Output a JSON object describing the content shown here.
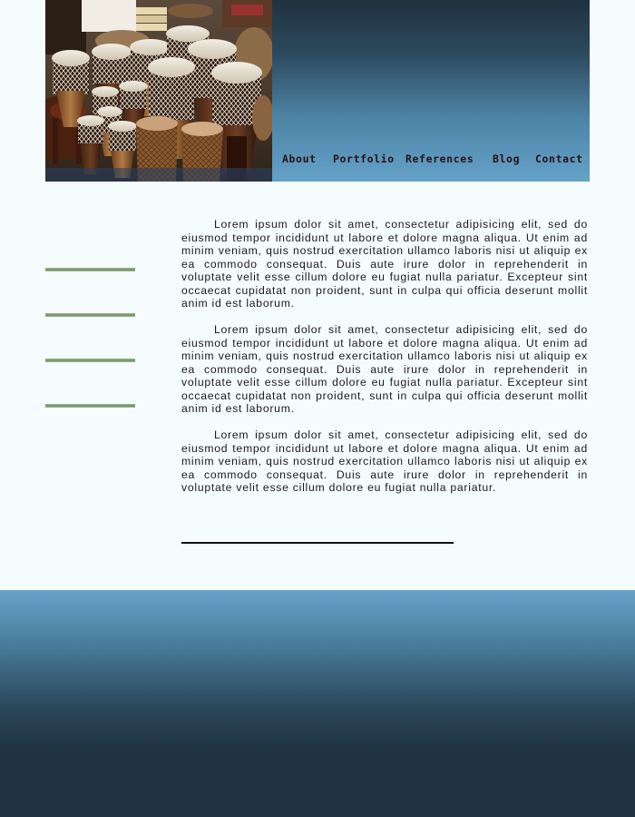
{
  "header": {
    "image_name": "djembe-drums-photo"
  },
  "nav": {
    "items": [
      {
        "label": "About"
      },
      {
        "label": "Portfolio"
      },
      {
        "label": "References"
      },
      {
        "label": "Blog"
      },
      {
        "label": "Contact"
      }
    ]
  },
  "content": {
    "paragraphs": [
      "Lorem ipsum dolor sit amet, consectetur adipisicing elit, sed do eiusmod tempor incididunt ut labore et dolore magna aliqua. Ut enim ad minim veniam, quis nostrud exercitation ullamco laboris nisi ut aliquip ex ea commodo consequat. Duis aute irure dolor in reprehenderit in voluptate velit esse cillum dolore eu fugiat nulla pariatur. Excepteur sint occaecat cupidatat non proident, sunt in culpa qui officia deserunt mollit anim id est laborum.",
      "Lorem ipsum dolor sit amet, consectetur adipisicing elit, sed do eiusmod tempor incididunt ut labore et dolore magna aliqua. Ut enim ad minim veniam, quis nostrud exercitation ullamco laboris nisi ut aliquip ex ea commodo consequat. Duis aute irure dolor in reprehenderit in voluptate velit esse cillum dolore eu fugiat nulla pariatur. Excepteur sint occaecat cupidatat non proident, sunt in culpa qui officia deserunt mollit anim id est laborum.",
      "Lorem ipsum dolor sit amet, consectetur adipisicing elit, sed do eiusmod tempor incididunt ut labore et dolore magna aliqua. Ut enim ad minim veniam, quis nostrud exercitation ullamco laboris nisi ut aliquip ex ea commodo consequat. Duis aute irure dolor in reprehenderit in voluptate velit esse cillum dolore eu fugiat nulla pariatur."
    ]
  },
  "colors": {
    "header_dark": "#1f3240",
    "header_light": "#64a2c8",
    "nav_text": "#2a1214",
    "sidebar_line": "#6f8f60",
    "page_background": "#f5fcfd",
    "body_text": "#1a1a1a"
  }
}
